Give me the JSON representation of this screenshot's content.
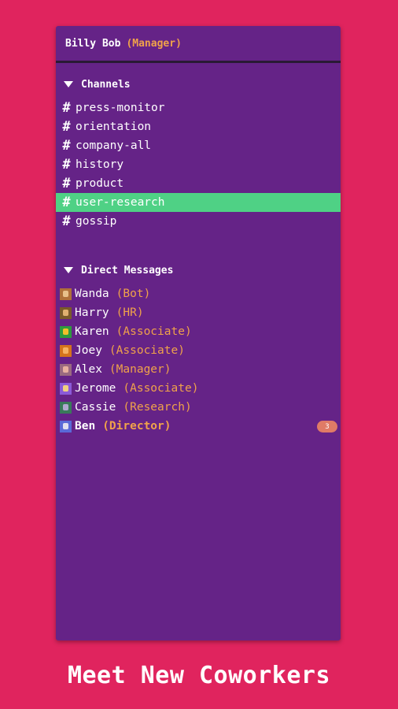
{
  "user": {
    "name": "Billy Bob",
    "role": "(Manager)"
  },
  "channels": {
    "title": "Channels",
    "items": [
      {
        "label": "press-monitor"
      },
      {
        "label": "orientation"
      },
      {
        "label": "company-all"
      },
      {
        "label": "history"
      },
      {
        "label": "product"
      },
      {
        "label": "user-research",
        "active": true
      },
      {
        "label": "gossip"
      }
    ]
  },
  "direct_messages": {
    "title": "Direct Messages",
    "items": [
      {
        "name": "Wanda",
        "role": "(Bot)",
        "avatar": "robot-avatar-icon",
        "colors": [
          "#b0703a",
          "#e8c08a"
        ]
      },
      {
        "name": "Harry",
        "role": "(HR)",
        "avatar": "person-avatar-icon",
        "colors": [
          "#7a5a2a",
          "#e0b070"
        ]
      },
      {
        "name": "Karen",
        "role": "(Associate)",
        "avatar": "person-avatar-icon",
        "colors": [
          "#2f9a3f",
          "#f2c02a"
        ]
      },
      {
        "name": "Joey",
        "role": "(Associate)",
        "avatar": "person-avatar-icon",
        "colors": [
          "#d5731c",
          "#f6b060"
        ]
      },
      {
        "name": "Alex",
        "role": "(Manager)",
        "avatar": "person-avatar-icon",
        "colors": [
          "#9a6a80",
          "#e8b0a0"
        ]
      },
      {
        "name": "Jerome",
        "role": "(Associate)",
        "avatar": "person-avatar-icon",
        "colors": [
          "#8b5ad8",
          "#f0d080"
        ]
      },
      {
        "name": "Cassie",
        "role": "(Research)",
        "avatar": "person-avatar-icon",
        "colors": [
          "#3a7a5a",
          "#b0a8d0"
        ]
      },
      {
        "name": "Ben",
        "role": "(Director)",
        "avatar": "person-avatar-icon",
        "colors": [
          "#5a6ad8",
          "#e0e0f0"
        ],
        "unread": "3"
      }
    ]
  },
  "tagline": "Meet New Coworkers",
  "colors": {
    "background": "#e0245e",
    "panel": "#652387",
    "active_channel": "#4fd185",
    "role": "#f0a24a",
    "badge": "#e07b66"
  }
}
